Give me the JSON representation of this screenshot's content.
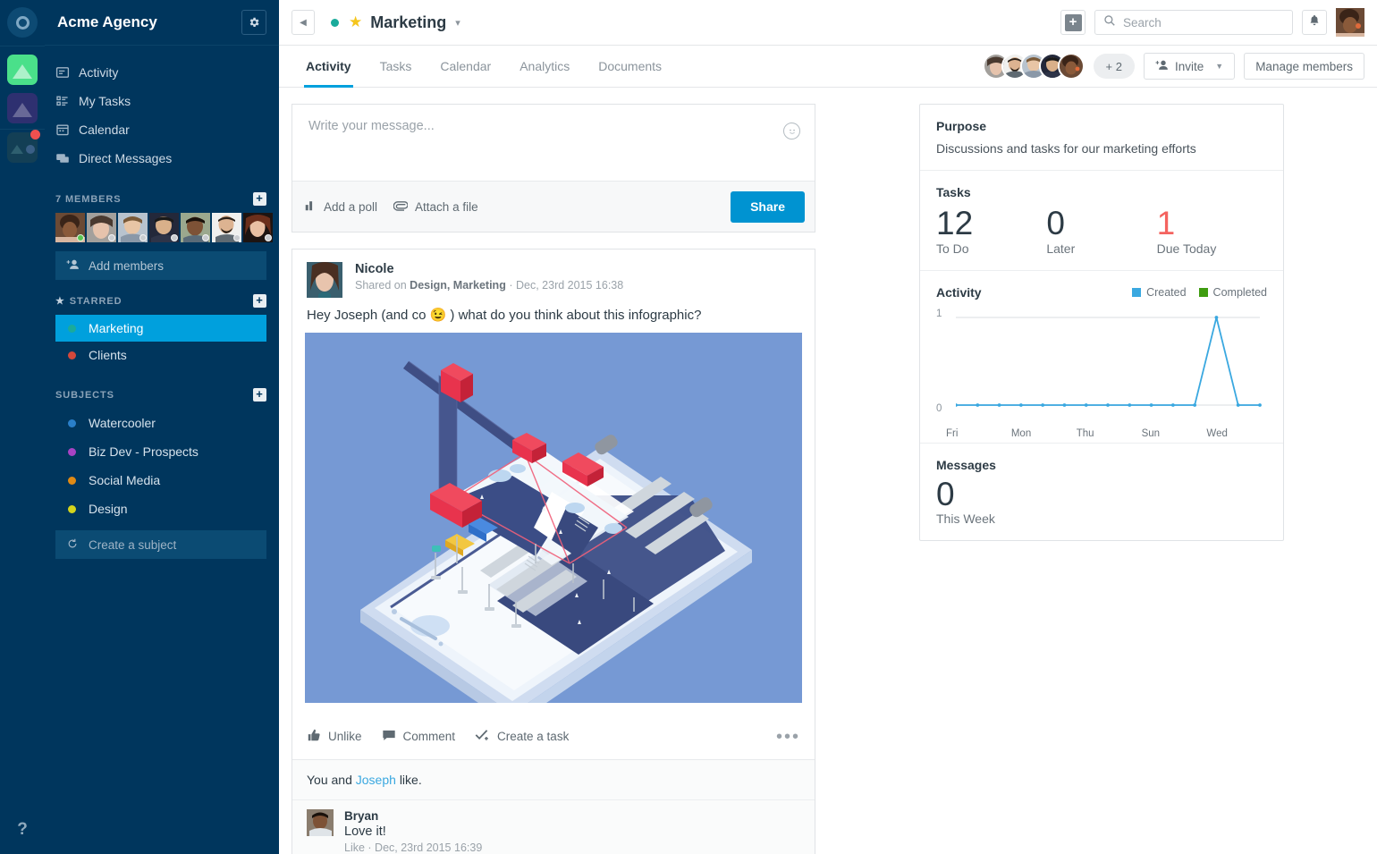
{
  "rail": {
    "logo_icon": "circle-logo-icon",
    "apps": [
      {
        "name": "app-tile-green",
        "icon": "triangle-icon",
        "badge": null
      },
      {
        "name": "app-tile-purple",
        "icon": "triangle-icon",
        "badge": null
      },
      {
        "name": "app-tile-dark",
        "icon": "triangle-circle-icon",
        "badge": "notification-dot"
      }
    ],
    "help_label": "?"
  },
  "sidebar": {
    "workspace_title": "Acme Agency",
    "settings_icon": "gear-icon",
    "nav": [
      {
        "label": "Activity",
        "icon": "activity-icon"
      },
      {
        "label": "My Tasks",
        "icon": "tasks-list-icon"
      },
      {
        "label": "Calendar",
        "icon": "calendar-icon"
      },
      {
        "label": "Direct Messages",
        "icon": "chat-icon"
      }
    ],
    "members_header": "7 MEMBERS",
    "add_members_label": "Add members",
    "starred_header": "STARRED",
    "starred": [
      {
        "label": "Marketing",
        "color": "#1aab9b",
        "active": true
      },
      {
        "label": "Clients",
        "color": "#d4483b",
        "active": false
      }
    ],
    "subjects_header": "SUBJECTS",
    "subjects": [
      {
        "label": "Watercooler",
        "color": "#2a7fc9"
      },
      {
        "label": "Biz Dev - Prospects",
        "color": "#a843c4"
      },
      {
        "label": "Social Media",
        "color": "#e08a14"
      },
      {
        "label": "Design",
        "color": "#d4d41c"
      }
    ],
    "create_subject_label": "Create a subject"
  },
  "topbar": {
    "back_icon": "chevron-left-icon",
    "project_status_color": "#1aab9b",
    "star_icon": "star-icon",
    "project_name": "Marketing",
    "dropdown_icon": "chevron-down-icon",
    "add_icon": "plus-icon",
    "search_placeholder": "Search",
    "search_value": "",
    "search_icon": "search-icon",
    "bell_icon": "bell-icon",
    "avatar_name": "user-avatar"
  },
  "tabs": [
    {
      "label": "Activity",
      "active": true
    },
    {
      "label": "Tasks",
      "active": false
    },
    {
      "label": "Calendar",
      "active": false
    },
    {
      "label": "Analytics",
      "active": false
    },
    {
      "label": "Documents",
      "active": false
    }
  ],
  "members_bar": {
    "overflow_label": "+ 2",
    "invite_label": "Invite",
    "invite_icon": "add-person-icon",
    "invite_caret": "chevron-down-icon",
    "manage_label": "Manage members"
  },
  "composer": {
    "placeholder": "Write your message...",
    "value": "",
    "emoji_icon": "emoji-smiley-icon",
    "poll_label": "Add a poll",
    "poll_icon": "bar-chart-icon",
    "attach_label": "Attach a file",
    "attach_icon": "paperclip-icon",
    "share_label": "Share"
  },
  "post": {
    "author": "Nicole",
    "meta_prefix": "Shared on",
    "meta_channels": "Design, Marketing",
    "meta_sep": "·",
    "meta_time": "Dec, 23rd 2015 16:38",
    "body": "Hey Joseph (and co 😉 ) what do you think about this infographic?",
    "image_alt": "isometric-smartphone-crane-infographic",
    "actions": [
      {
        "label": "Unlike",
        "icon": "thumbs-up-icon"
      },
      {
        "label": "Comment",
        "icon": "comment-icon"
      },
      {
        "label": "Create a task",
        "icon": "check-plus-icon"
      }
    ],
    "more_icon": "more-horizontal-icon",
    "likes_pre": "You  and",
    "likes_link": "Joseph",
    "likes_post": "like.",
    "comments": [
      {
        "author": "Bryan",
        "text": "Love it!",
        "meta": "Like · Dec, 23rd 2015 16:39"
      }
    ]
  },
  "rightpanel": {
    "purpose_title": "Purpose",
    "purpose_text": "Discussions and tasks for our marketing efforts",
    "tasks_title": "Tasks",
    "tasks": [
      {
        "value": "12",
        "label": "To Do",
        "red": false
      },
      {
        "value": "0",
        "label": "Later",
        "red": false
      },
      {
        "value": "1",
        "label": "Due Today",
        "red": true
      }
    ],
    "activity_title": "Activity",
    "legend": [
      {
        "label": "Created",
        "color": "#3aa8e0"
      },
      {
        "label": "Completed",
        "color": "#3f9c10"
      }
    ],
    "messages_title": "Messages",
    "messages_value": "0",
    "messages_label": "This Week"
  },
  "chart_data": {
    "type": "line",
    "title": "Activity",
    "xlabel": "",
    "ylabel": "",
    "ylim": [
      0,
      1
    ],
    "yticks": [
      0,
      1
    ],
    "ytick_labels": [
      "0",
      "1"
    ],
    "grid": true,
    "legend_position": "top-right",
    "x": [
      1,
      2,
      3,
      4,
      5,
      6,
      7,
      8,
      9,
      10,
      11,
      12,
      13,
      14,
      15
    ],
    "tick_labels": [
      "Fri",
      "",
      "",
      "Mon",
      "",
      "",
      "Thu",
      "",
      "",
      "Sun",
      "",
      "",
      "Wed",
      "",
      ""
    ],
    "series": [
      {
        "name": "Created",
        "color": "#3aa8e0",
        "values": [
          0,
          0,
          0,
          0,
          0,
          0,
          0,
          0,
          0,
          0,
          0,
          0,
          1,
          0,
          0
        ]
      },
      {
        "name": "Completed",
        "color": "#3f9c10",
        "values": [
          0,
          0,
          0,
          0,
          0,
          0,
          0,
          0,
          0,
          0,
          0,
          0,
          0,
          0,
          0
        ]
      }
    ]
  }
}
